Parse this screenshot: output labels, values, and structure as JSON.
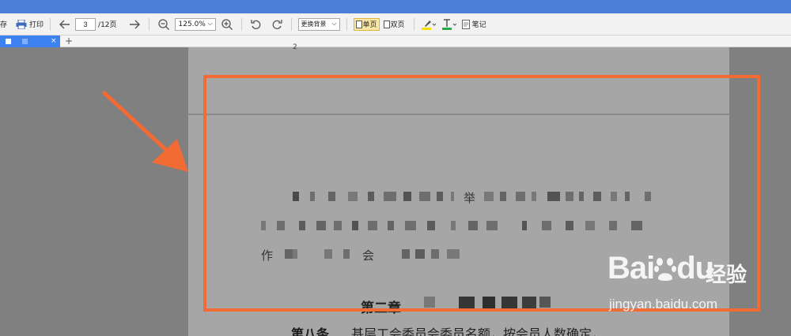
{
  "toolbar": {
    "save_label": "存",
    "print_label": "打印",
    "page_current": "3",
    "page_total": "/12页",
    "zoom_value": "125.0%",
    "bg_label": "更换背景",
    "single_page_label": "单页",
    "double_page_label": "双页",
    "notes_label": "笔记"
  },
  "tabs": {
    "close_label": "×",
    "add_label": "+"
  },
  "document": {
    "page_number": "2",
    "para1_fragment": "举",
    "para3_start": "作",
    "para3_mid": "会",
    "chapter_heading": "第二章",
    "article_label": "第八条",
    "article_text": "基层工会委员会委员名额，按会员人数确定，"
  },
  "watermark": {
    "brand": "Bai",
    "brand_suffix": "du",
    "cn": "经验",
    "url": "jingyan.baidu.com"
  },
  "colors": {
    "accent": "#4a7fd6",
    "tab_active": "#3e82f0",
    "highlight": "#f26a34"
  }
}
